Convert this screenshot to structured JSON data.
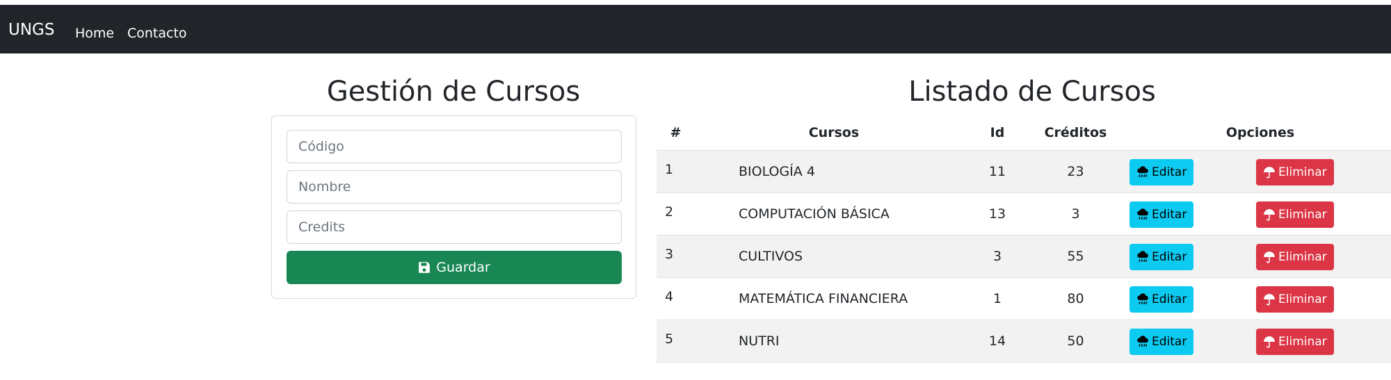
{
  "navbar": {
    "brand": "UNGS",
    "links": [
      "Home",
      "Contacto"
    ]
  },
  "form": {
    "title": "Gestión de Cursos",
    "code_placeholder": "Código",
    "name_placeholder": "Nombre",
    "credits_placeholder": "Credits",
    "save_label": "Guardar"
  },
  "list": {
    "title": "Listado de Cursos",
    "headers": [
      "#",
      "Cursos",
      "Id",
      "Créditos",
      "Opciones"
    ],
    "edit_label": "Editar",
    "delete_label": "Eliminar",
    "rows": [
      {
        "num": "1",
        "course": "BIOLOGÍA 4",
        "id": "11",
        "credits": "23"
      },
      {
        "num": "2",
        "course": "COMPUTACIÓN BÁSICA",
        "id": "13",
        "credits": "3"
      },
      {
        "num": "3",
        "course": "CULTIVOS",
        "id": "3",
        "credits": "55"
      },
      {
        "num": "4",
        "course": "MATEMÁTICA FINANCIERA",
        "id": "1",
        "credits": "80"
      },
      {
        "num": "5",
        "course": "NUTRI",
        "id": "14",
        "credits": "50"
      }
    ]
  },
  "colors": {
    "navbar": "#212529",
    "save": "#198754",
    "edit": "#0dcaf0",
    "delete": "#dc3545"
  },
  "icons": {
    "save": "floppy-disk-icon",
    "edit": "cloud-rain-icon",
    "delete": "umbrella-icon"
  }
}
